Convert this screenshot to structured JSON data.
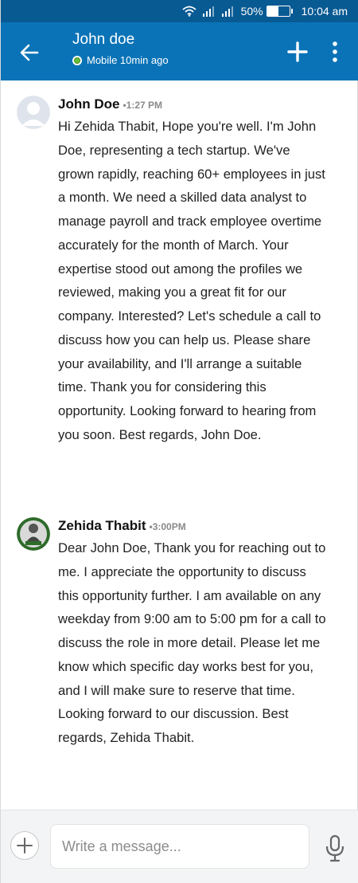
{
  "status_bar": {
    "battery_text": "50%",
    "battery_level": 0.5,
    "time": "10:04 am",
    "icons": [
      "wifi-icon",
      "signal-icon",
      "signal-icon",
      "battery-icon"
    ]
  },
  "header": {
    "contact_name": "John doe",
    "presence": "Mobile 10min ago",
    "icons": [
      "arrow-left-icon",
      "plus-icon",
      "more-vertical-icon"
    ]
  },
  "messages": [
    {
      "sender": "John Doe",
      "time": "•1:27 PM",
      "avatar": "default-avatar-icon",
      "text": "Hi Zehida Thabit, Hope you're well. I'm John Doe, representing a tech startup. We've grown rapidly, reaching 60+ employees in just a month. We need a skilled data analyst to manage payroll and track employee overtime accurately for the month of March. Your expertise stood out among the profiles we reviewed, making you a great fit for our company. Interested? Let's schedule a call to discuss how you can help us. Please share your availability, and I'll arrange a suitable time. Thank you for considering this opportunity. Looking forward to hearing from you soon. Best regards, John Doe."
    },
    {
      "sender": "Zehida Thabit",
      "time": "•3:00PM",
      "avatar": "profile-photo-icon",
      "text": "Dear John Doe, Thank you for reaching out to me. I appreciate the opportunity to discuss this opportunity further. I am available on any weekday from 9:00 am to 5:00 pm for a call to discuss the role in more detail. Please let me know which specific day works best for you, and I will make sure to reserve that time. Looking forward to our discussion. Best regards, Zehida Thabit."
    }
  ],
  "composer": {
    "placeholder": "Write a message...",
    "value": "",
    "icons": [
      "plus-icon",
      "microphone-icon"
    ]
  },
  "colors": {
    "status_bar": "#085a93",
    "header": "#0a73b7",
    "online": "#6abf3a",
    "composer_bg": "#f2f4f6"
  }
}
